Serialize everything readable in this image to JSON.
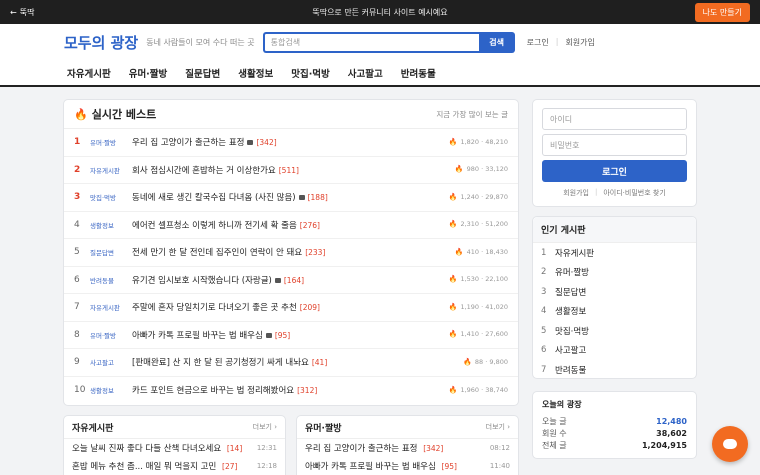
{
  "topbar": {
    "back_label": "뚝딱",
    "notice": "뚝딱으로 만든 커뮤니티 사이트 예시예요",
    "make_button": "나도 만들기"
  },
  "header": {
    "logo": "모두의 광장",
    "tagline": "동네 사람들이 모여 수다 떠는 곳",
    "search_placeholder": "통합검색",
    "search_button": "검색",
    "login": "로그인",
    "signup": "회원가입"
  },
  "nav": [
    "자유게시판",
    "유머·짤방",
    "질문답변",
    "생활정보",
    "맛집·먹방",
    "사고팔고",
    "반려동물"
  ],
  "best": {
    "title": "실시간 베스트",
    "subtitle": "지금 가장 많이 보는 글",
    "rows": [
      {
        "rank": "1",
        "cat": "유머·짤방",
        "title": "우리 집 고양이가 출근하는 표정",
        "img": true,
        "comments": "[342]",
        "likes": "1,820",
        "views": "48,210"
      },
      {
        "rank": "2",
        "cat": "자유게시판",
        "title": "회사 점심시간에 혼밥하는 거 이상한가요",
        "img": false,
        "comments": "[511]",
        "likes": "980",
        "views": "33,120"
      },
      {
        "rank": "3",
        "cat": "맛집·먹방",
        "title": "동네에 새로 생긴 칼국수집 다녀옴 (사진 많음)",
        "img": true,
        "comments": "[188]",
        "likes": "1,240",
        "views": "29,870"
      },
      {
        "rank": "4",
        "cat": "생활정보",
        "title": "에어컨 셀프청소 이렇게 하니까 전기세 확 줄음",
        "img": false,
        "comments": "[276]",
        "likes": "2,310",
        "views": "51,200"
      },
      {
        "rank": "5",
        "cat": "질문답변",
        "title": "전세 만기 한 달 전인데 집주인이 연락이 안 돼요",
        "img": false,
        "comments": "[233]",
        "likes": "410",
        "views": "18,430"
      },
      {
        "rank": "6",
        "cat": "반려동물",
        "title": "유기견 임시보호 시작했습니다 (자랑글)",
        "img": true,
        "comments": "[164]",
        "likes": "1,530",
        "views": "22,100"
      },
      {
        "rank": "7",
        "cat": "자유게시판",
        "title": "주말에 혼자 당일치기로 다녀오기 좋은 곳 추천",
        "img": false,
        "comments": "[209]",
        "likes": "1,190",
        "views": "41,020"
      },
      {
        "rank": "8",
        "cat": "유머·짤방",
        "title": "아빠가 카톡 프로필 바꾸는 법 배우심",
        "img": true,
        "comments": "[95]",
        "likes": "1,410",
        "views": "27,600"
      },
      {
        "rank": "9",
        "cat": "사고팔고",
        "title": "[판매완료] 산 지 한 달 된 공기청정기 싸게 내놔요",
        "img": false,
        "comments": "[41]",
        "likes": "88",
        "views": "9,800"
      },
      {
        "rank": "10",
        "cat": "생활정보",
        "title": "카드 포인트 현금으로 바꾸는 법 정리해봤어요",
        "img": false,
        "comments": "[312]",
        "likes": "1,960",
        "views": "38,740"
      }
    ]
  },
  "boards": [
    {
      "title": "자유게시판",
      "more": "더보기",
      "rows": [
        {
          "title": "오늘 날씨 진짜 좋다 다들 산책 다녀오세요",
          "comments": "[14]",
          "time": "12:31"
        },
        {
          "title": "혼밥 메뉴 추천 좀... 매일 뭐 먹을지 고민",
          "comments": "[27]",
          "time": "12:18"
        }
      ]
    },
    {
      "title": "유머·짤방",
      "more": "더보기",
      "rows": [
        {
          "title": "우리 집 고양이가 출근하는 표정",
          "comments": "[342]",
          "time": "08:12"
        },
        {
          "title": "아빠가 카톡 프로필 바꾸는 법 배우심",
          "comments": "[95]",
          "time": "11:40"
        }
      ]
    }
  ],
  "login": {
    "id_placeholder": "아이디",
    "pw_placeholder": "비밀번호",
    "button": "로그인",
    "signup": "회원가입",
    "find": "아이디·비밀번호 찾기"
  },
  "popular": {
    "title": "인기 게시판",
    "items": [
      "자유게시판",
      "유머·짤방",
      "질문답변",
      "생활정보",
      "맛집·먹방",
      "사고팔고",
      "반려동물"
    ]
  },
  "site_stats": {
    "title": "오늘의 광장",
    "rows": [
      {
        "label": "오늘 글",
        "value": "12,480",
        "highlight": true
      },
      {
        "label": "회원 수",
        "value": "38,602",
        "highlight": false
      },
      {
        "label": "전체 글",
        "value": "1,204,915",
        "highlight": false
      }
    ]
  },
  "colors": {
    "accent": "#2d63c8",
    "orange": "#f26b21",
    "comment_red": "#e0402a"
  }
}
